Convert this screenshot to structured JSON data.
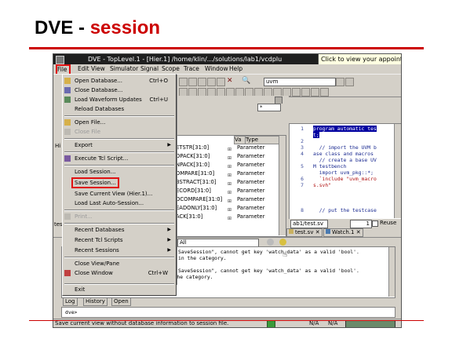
{
  "slide": {
    "title_main": "DVE - ",
    "title_accent": "session"
  },
  "window": {
    "title": "DVE - TopLevel.1 - [Hier.1]  /home/klin/.../solutions/lab1/vcdplu",
    "tooltip": "Click to view your appoint"
  },
  "menubar": [
    "File",
    "Edit",
    "View",
    "Simulator",
    "Signal",
    "Scope",
    "Trace",
    "Window",
    "Help"
  ],
  "toolbar": {
    "search_value": "uvm",
    "filter_value": "*"
  },
  "file_menu": {
    "items": [
      {
        "label": "Open Database...",
        "accel": "Ctrl+O",
        "icon": "folder-icon",
        "disabled": false
      },
      {
        "label": "Close Database...",
        "accel": "",
        "icon": "database-icon",
        "disabled": false
      },
      {
        "label": "Load Waveform Updates",
        "accel": "Ctrl+U",
        "icon": "waveform-icon",
        "disabled": false
      },
      {
        "label": "Reload Databases",
        "accel": "",
        "icon": "",
        "disabled": false
      },
      {
        "label": "Open File...",
        "accel": "",
        "icon": "folder-icon",
        "disabled": false
      },
      {
        "label": "Close File",
        "accel": "",
        "icon": "file-icon",
        "disabled": true
      },
      {
        "label": "Export",
        "accel": "",
        "icon": "",
        "disabled": false,
        "submenu": true
      },
      {
        "label": "Execute Tcl Script...",
        "accel": "",
        "icon": "script-icon",
        "disabled": false
      },
      {
        "label": "Load Session...",
        "accel": "",
        "icon": "",
        "disabled": false
      },
      {
        "label": "Save Session...",
        "accel": "",
        "icon": "",
        "disabled": false,
        "highlighted": true
      },
      {
        "label": "Save Current View (Hier.1)...",
        "accel": "",
        "icon": "",
        "disabled": false
      },
      {
        "label": "Load Last Auto-Session...",
        "accel": "",
        "icon": "",
        "disabled": false
      },
      {
        "label": "Print...",
        "accel": "",
        "icon": "printer-icon",
        "disabled": true
      },
      {
        "label": "Recent Databases",
        "accel": "",
        "icon": "",
        "disabled": false,
        "submenu": true
      },
      {
        "label": "Recent Tcl Scripts",
        "accel": "",
        "icon": "",
        "disabled": false,
        "submenu": true
      },
      {
        "label": "Recent Sessions",
        "accel": "",
        "icon": "",
        "disabled": false,
        "submenu": true
      },
      {
        "label": "Close View/Pane",
        "accel": "",
        "icon": "",
        "disabled": false
      },
      {
        "label": "Close Window",
        "accel": "Ctrl+W",
        "icon": "close-window-icon",
        "disabled": false
      },
      {
        "label": "Exit",
        "accel": "",
        "icon": "",
        "disabled": false
      }
    ]
  },
  "signal_pane": {
    "headers": [
      "Va",
      "Type"
    ],
    "rows": [
      {
        "name": "ETSTR[31:0]",
        "type": "Parameter"
      },
      {
        "name": "OPACK[31:0]",
        "type": "Parameter"
      },
      {
        "name": "NPACK[31:0]",
        "type": "Parameter"
      },
      {
        "name": "OMPARE[31:0]",
        "type": "Parameter"
      },
      {
        "name": "BSTRACT[31:0]",
        "type": "Parameter"
      },
      {
        "name": "ECORD[31:0]",
        "type": "Parameter"
      },
      {
        "name": "OCOMPARE[31:0]",
        "type": "Parameter"
      },
      {
        "name": "EADONLY[31:0]",
        "type": "Parameter"
      },
      {
        "name": "ACK[31:0]",
        "type": "Parameter"
      }
    ],
    "left_labels": [
      "Hi",
      "",
      "",
      "tes"
    ]
  },
  "source_pane": {
    "line_numbers": [
      "1",
      "",
      "2",
      "3",
      "4",
      "",
      "5",
      "",
      "6",
      "7",
      "",
      "",
      "",
      "8"
    ],
    "lines": [
      "program automatic tes",
      "t;",
      "",
      "  // import the UVM b",
      "ase class and macros",
      "  // create a base UV",
      "M testbench",
      "  import uvm_pkg::*;",
      "  `include \"uvm_macro",
      "s.svh\"",
      "",
      "",
      "",
      "  // put the testcase"
    ],
    "file_field": "ab1/test.sv",
    "line_field": "1",
    "reuse_label": "Reuse"
  },
  "tabs_mid": [
    {
      "label": "test.sv"
    },
    {
      "label": "Watch.1"
    }
  ],
  "console": {
    "filter_value": "All",
    "lines": [
      "SaveSession\", cannot get key 'watch_data' as a valid 'bool'.",
      "in the category.",
      "",
      "SaveSession\", cannot get key 'watch_data' as a valid 'bool'.",
      "Please check the type of the key in the category."
    ],
    "tabs": [
      "Log",
      "History",
      "Open"
    ],
    "prompt": "dve>"
  },
  "status": {
    "message": "Save current view without database information to session file.",
    "na1": "N/A",
    "na2": "N/A"
  }
}
